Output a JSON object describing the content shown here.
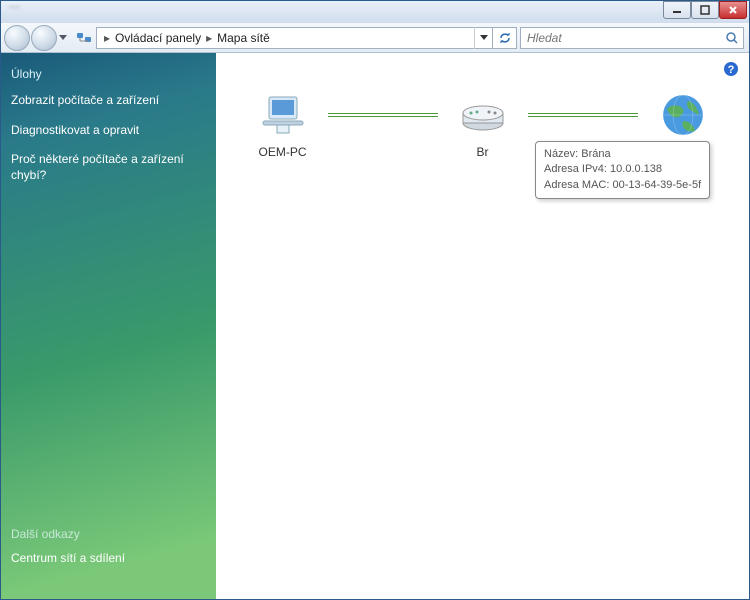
{
  "breadcrumb": {
    "seg1": "Ovládací panely",
    "seg2": "Mapa sítě"
  },
  "search": {
    "placeholder": "Hledat"
  },
  "sidebar": {
    "title": "Úlohy",
    "links": [
      "Zobrazit počítače a zařízení",
      "Diagnostikovat a opravit",
      "Proč některé počítače a zařízení chybí?"
    ],
    "bottom_title": "Další odkazy",
    "bottom_link": "Centrum sítí a sdílení"
  },
  "nodes": {
    "pc": "OEM-PC",
    "gateway": "Br",
    "internet": "Internet"
  },
  "tooltip": {
    "line1": "Název: Brána",
    "line2": "Adresa IPv4: 10.0.0.138",
    "line3": "Adresa MAC: 00-13-64-39-5e-5f"
  }
}
